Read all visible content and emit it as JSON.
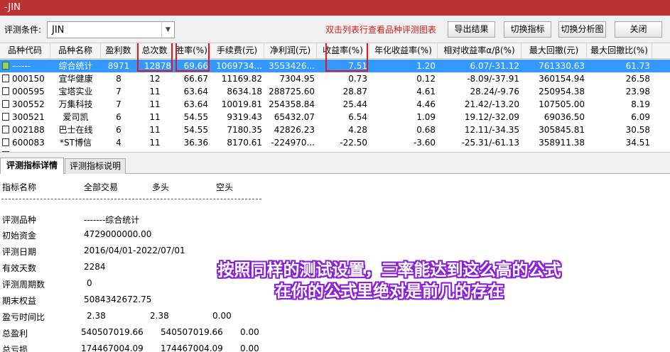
{
  "window": {
    "title": "-JIN"
  },
  "toolbar": {
    "condition_label": "评测条件:",
    "condition_value": "JIN",
    "hint": "双击列表行查看品种评测图表",
    "export_label": "导出结果",
    "switch_indicator_label": "切换指标",
    "switch_chart_label": "切换分析图",
    "close_label": "关闭"
  },
  "table": {
    "columns": [
      "品种代码",
      "品种名称",
      "盈利数",
      "总次数",
      "胜率(%)",
      "手续费(元)",
      "净利润(元)",
      "收益率(%)",
      "年化收益率(%)",
      "相对收益率α/β(%)",
      "最大回撤(元)",
      "最大回撤比(%)"
    ],
    "rows": [
      [
        "------",
        "综合统计",
        "8971",
        "12878",
        "69.66",
        "1069734...",
        "3553426...",
        "7.51",
        "1.20",
        "6.07/-31.12",
        "761330.63",
        "61.73"
      ],
      [
        "000150",
        "宜华健康",
        "8",
        "12",
        "66.67",
        "11169.82",
        "7304.95",
        "0.73",
        "0.12",
        "-8.09/-37.91",
        "360154.94",
        "26.58"
      ],
      [
        "000595",
        "宝塔实业",
        "7",
        "11",
        "63.64",
        "8634.18",
        "288725.60",
        "28.87",
        "4.61",
        "28.24/-9.76",
        "250954.38",
        "23.98"
      ],
      [
        "300552",
        "万集科技",
        "7",
        "11",
        "63.64",
        "10019.81",
        "254358.84",
        "25.44",
        "4.46",
        "21.42/-13.20",
        "107505.00",
        "8.19"
      ],
      [
        "300521",
        "爱司凯",
        "6",
        "11",
        "54.55",
        "9319.43",
        "65432.07",
        "6.54",
        "1.09",
        "19.12/-32.09",
        "69036.50",
        "6.09"
      ],
      [
        "002188",
        "巴士在线",
        "6",
        "11",
        "54.55",
        "7180.35",
        "42826.23",
        "4.28",
        "0.68",
        "12.11/-34.35",
        "305845.81",
        "30.58"
      ],
      [
        "600083",
        "*ST博信",
        "4",
        "11",
        "36.36",
        "8170.61",
        "-224970...",
        "-22.50",
        "-3.60",
        "-25.31/-61.13",
        "358911.38",
        "34.51"
      ]
    ]
  },
  "tabs": [
    "评测指标详情",
    "评测指标说明"
  ],
  "detail": {
    "headers": [
      "指标名称",
      "全部交易",
      "多头",
      "空头"
    ],
    "items": [
      {
        "name": "评测品种",
        "v1": "-------综合统计",
        "v2": "",
        "v3": ""
      },
      {
        "name": "初始资金",
        "v1": "4729000000.00",
        "v2": "",
        "v3": ""
      },
      {
        "name": "评测日期",
        "v1": "2016/04/01-2022/07/01",
        "v2": "",
        "v3": ""
      },
      {
        "name": "有效天数",
        "v1": "2284",
        "v2": "",
        "v3": ""
      },
      {
        "name": "评测周期数",
        "v1": "0",
        "v2": "",
        "v3": ""
      },
      {
        "name": "期末权益",
        "v1": "5084342672.75",
        "v2": "",
        "v3": ""
      },
      {
        "name": "盈亏时间比",
        "v1": "2.38",
        "v2": "2.38",
        "v3": "0.00"
      },
      {
        "name": "总盈利",
        "v1": "540507019.66",
        "v2": "540507019.66",
        "v3": "0.00"
      },
      {
        "name": "总亏损",
        "v1": "174467004.09",
        "v2": "174467004.09",
        "v3": "0.00"
      }
    ]
  },
  "overlay": {
    "line1": "按照同样的测试设置，三率能达到这么高的公式",
    "line2": "在你的公式里绝对是前几的存在"
  },
  "colors": {
    "titlebar": "#ba3232",
    "selection": "#3399ff",
    "highlight_box": "#e4161d",
    "overlay_outline": "#8b1fd9"
  }
}
